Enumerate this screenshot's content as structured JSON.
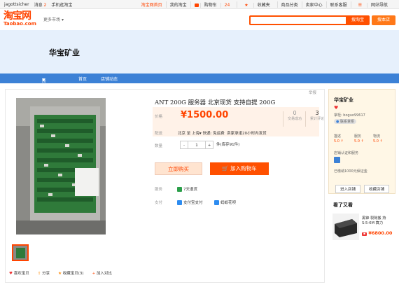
{
  "topbar": {
    "username": "jagottsicher",
    "messages_label": "消息",
    "messages_count": "2",
    "mobile_label": "手机逛淘宝",
    "taobao_home": "淘宝网首页",
    "my_taobao": "我的淘宝",
    "cart_label": "购物车",
    "cart_count": "24",
    "favorites": "收藏夹",
    "categories": "商品分类",
    "seller_center": "卖家中心",
    "customer_service": "联系客服",
    "site_nav": "网站导航"
  },
  "header": {
    "logo_cn": "淘宝网",
    "logo_en": "Taobao.com",
    "more_markets": "更多市场",
    "search_placeholder": "",
    "search_taobao": "搜淘宝",
    "search_shop": "搜本店"
  },
  "shop": {
    "name": "华宝矿业"
  },
  "nav": {
    "items": [
      "所有分类",
      "首页",
      "店铺动态"
    ]
  },
  "product": {
    "title": "ANT 200G 服务器 北京现货 支持自提 200G",
    "report": "举报",
    "price_label": "价格",
    "price": "¥1500.00",
    "deals_count": "0",
    "deals_label": "交易成功",
    "reviews_count": "3",
    "reviews_label": "累计评论",
    "shipping_label": "配送",
    "shipping_from": "北京",
    "shipping_to_word": "至",
    "shipping_to": "上海",
    "shipping_fee": "快递: 免运费",
    "shipping_promise": "卖家承诺20小时内发货",
    "qty_label": "数量",
    "qty_value": "1",
    "qty_minus": "-",
    "qty_plus": "+",
    "stock": "件(库存91件)",
    "buy_now": "立即购买",
    "add_to_cart": "加入购物车",
    "service_label": "服务",
    "service_item": "7天退货",
    "pay_label": "支付",
    "pay_alipay": "支付宝支付",
    "pay_huabei": "蚂蚁花呗",
    "actions": {
      "favorite_item": "喜欢宝贝",
      "share": "分享",
      "collect": "收藏宝贝(3)",
      "compare": "加入对比"
    }
  },
  "sidebar": {
    "shop_name": "华宝矿业",
    "seller_prefix": "掌柜:",
    "seller_id": "boguo99617",
    "contact": "联系掌柜",
    "scores": [
      {
        "label": "描述",
        "value": "5.0"
      },
      {
        "label": "服务",
        "value": "5.0"
      },
      {
        "label": "物流",
        "value": "5.0"
      }
    ],
    "cert_label": "店铺认证和服务",
    "deposit": "已缴纳1000元保证金",
    "enter_shop": "进入店铺",
    "fav_shop": "收藏店铺"
  },
  "recommend": {
    "header": "看了又看",
    "title": "黑锋 裂隙搬 持 S:5-6M 算力",
    "price": "¥6800.00"
  },
  "colors": {
    "accent": "#ff5000",
    "nav_blue": "#3c81d6",
    "banner_bg": "#e6f0fc"
  }
}
